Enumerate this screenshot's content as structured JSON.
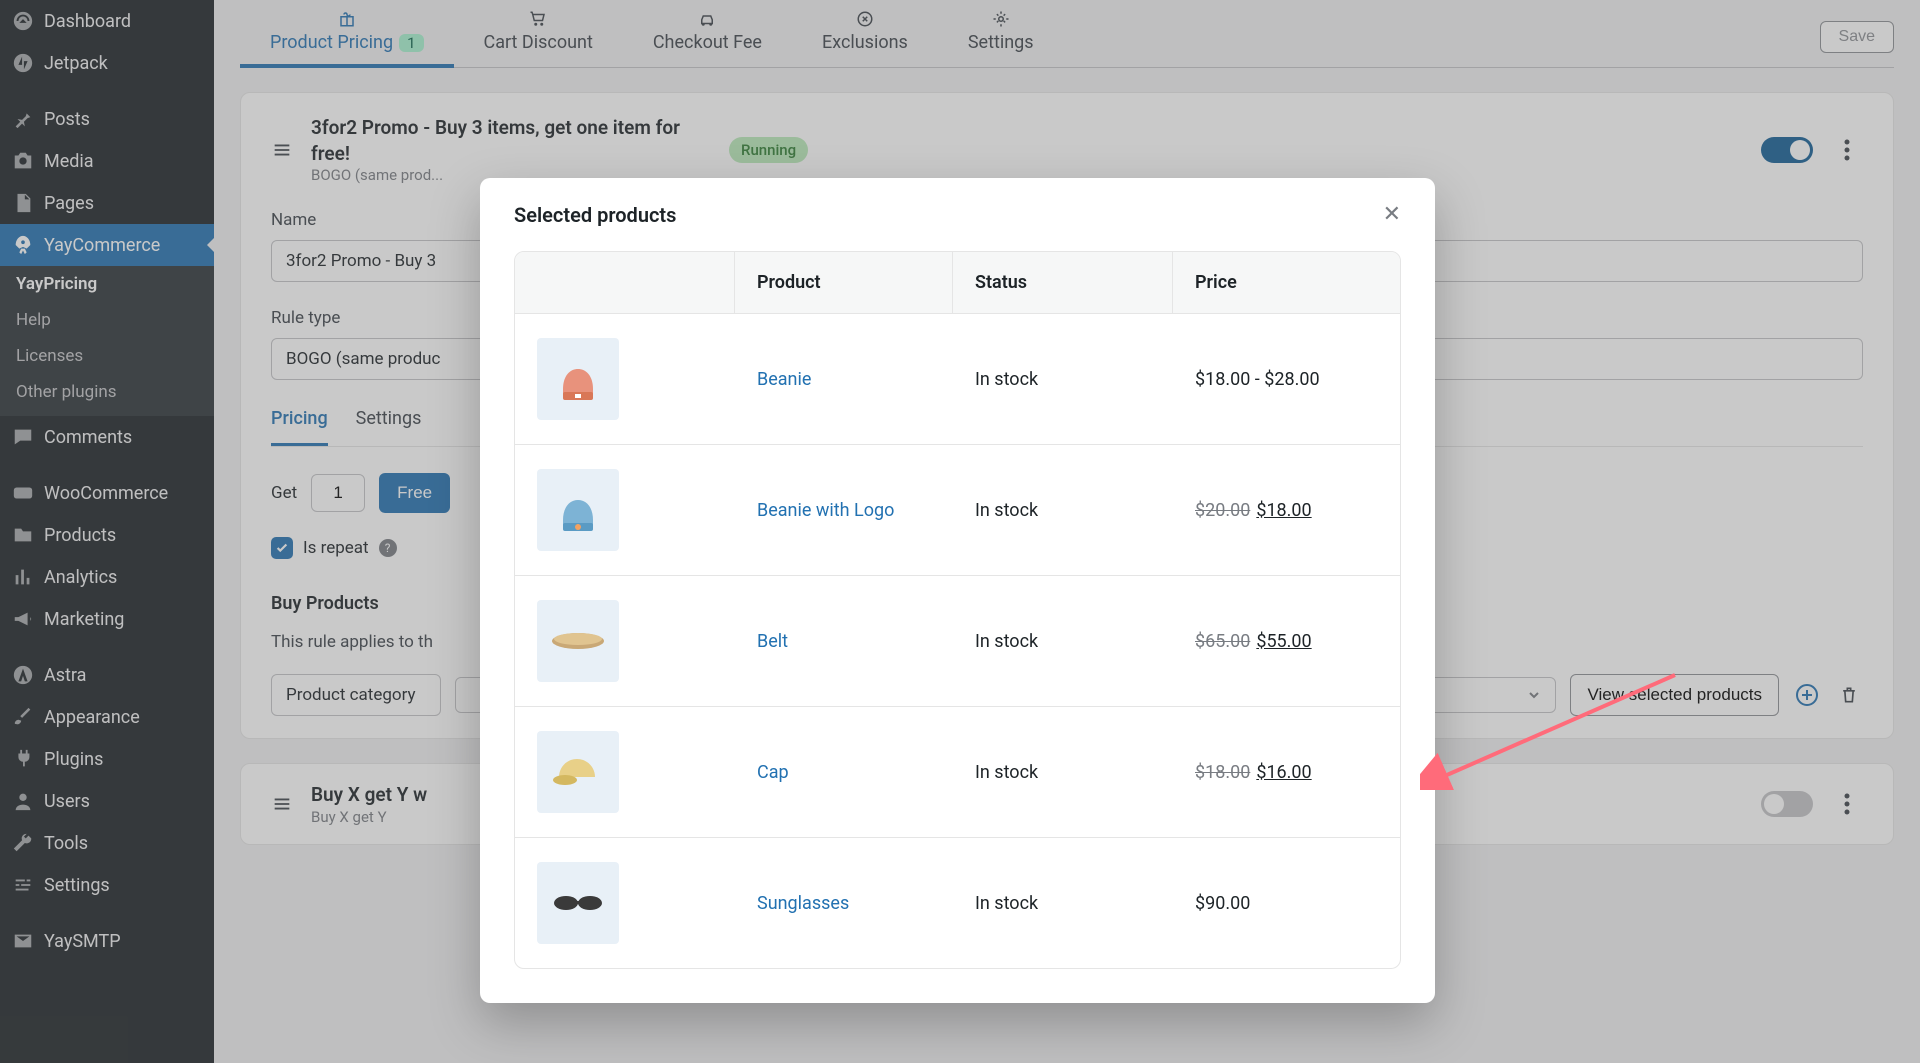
{
  "sidebar": {
    "items": [
      {
        "label": "Dashboard",
        "icon": "speedometer"
      },
      {
        "label": "Jetpack",
        "icon": "circle-arrow"
      },
      {
        "label": "Posts",
        "icon": "pin"
      },
      {
        "label": "Media",
        "icon": "camera"
      },
      {
        "label": "Pages",
        "icon": "page"
      },
      {
        "label": "YayCommerce",
        "icon": "rocket",
        "active": true
      },
      {
        "label": "Comments",
        "icon": "comment"
      },
      {
        "label": "WooCommerce",
        "icon": "woo"
      },
      {
        "label": "Products",
        "icon": "folder"
      },
      {
        "label": "Analytics",
        "icon": "bars"
      },
      {
        "label": "Marketing",
        "icon": "megaphone"
      },
      {
        "label": "Astra",
        "icon": "astra"
      },
      {
        "label": "Appearance",
        "icon": "brush"
      },
      {
        "label": "Plugins",
        "icon": "plug"
      },
      {
        "label": "Users",
        "icon": "user"
      },
      {
        "label": "Tools",
        "icon": "wrench"
      },
      {
        "label": "Settings",
        "icon": "sliders"
      },
      {
        "label": "YaySMTP",
        "icon": "mail"
      }
    ],
    "sub": [
      "YayPricing",
      "Help",
      "Licenses",
      "Other plugins"
    ]
  },
  "tabs": [
    {
      "label": "Product Pricing",
      "badge": "1",
      "active": true
    },
    {
      "label": "Cart Discount"
    },
    {
      "label": "Checkout Fee"
    },
    {
      "label": "Exclusions"
    },
    {
      "label": "Settings"
    }
  ],
  "save_label": "Save",
  "rule1": {
    "title": "3for2 Promo - Buy 3 items, get one item for free!",
    "subtitle": "BOGO (same prod...",
    "status": "Running",
    "name_label": "Name",
    "name_value": "3for2 Promo - Buy 3",
    "type_label": "Rule type",
    "type_value": "BOGO (same produc",
    "subtabs": [
      "Pricing",
      "Settings"
    ],
    "get_label": "Get",
    "get_value": "1",
    "free_label": "Free",
    "repeat_label": "Is repeat",
    "buy_title": "Buy Products",
    "buy_desc": "This rule applies to th",
    "category_label": "Product category",
    "view_btn": "View selected products"
  },
  "rule2": {
    "title": "Buy X get Y w",
    "subtitle": "Buy X get Y"
  },
  "modal": {
    "title": "Selected products",
    "headers": [
      "",
      "Product",
      "Status",
      "Price"
    ],
    "rows": [
      {
        "name": "Beanie",
        "status": "In stock",
        "price": "$18.00 - $28.00",
        "thumb": "beanie-orange"
      },
      {
        "name": "Beanie with Logo",
        "status": "In stock",
        "old": "$20.00",
        "new": "$18.00",
        "thumb": "beanie-blue"
      },
      {
        "name": "Belt",
        "status": "In stock",
        "old": "$65.00",
        "new": "$55.00",
        "thumb": "belt"
      },
      {
        "name": "Cap",
        "status": "In stock",
        "old": "$18.00",
        "new": "$16.00",
        "thumb": "cap"
      },
      {
        "name": "Sunglasses",
        "status": "In stock",
        "price": "$90.00",
        "thumb": "sunglasses"
      }
    ]
  }
}
